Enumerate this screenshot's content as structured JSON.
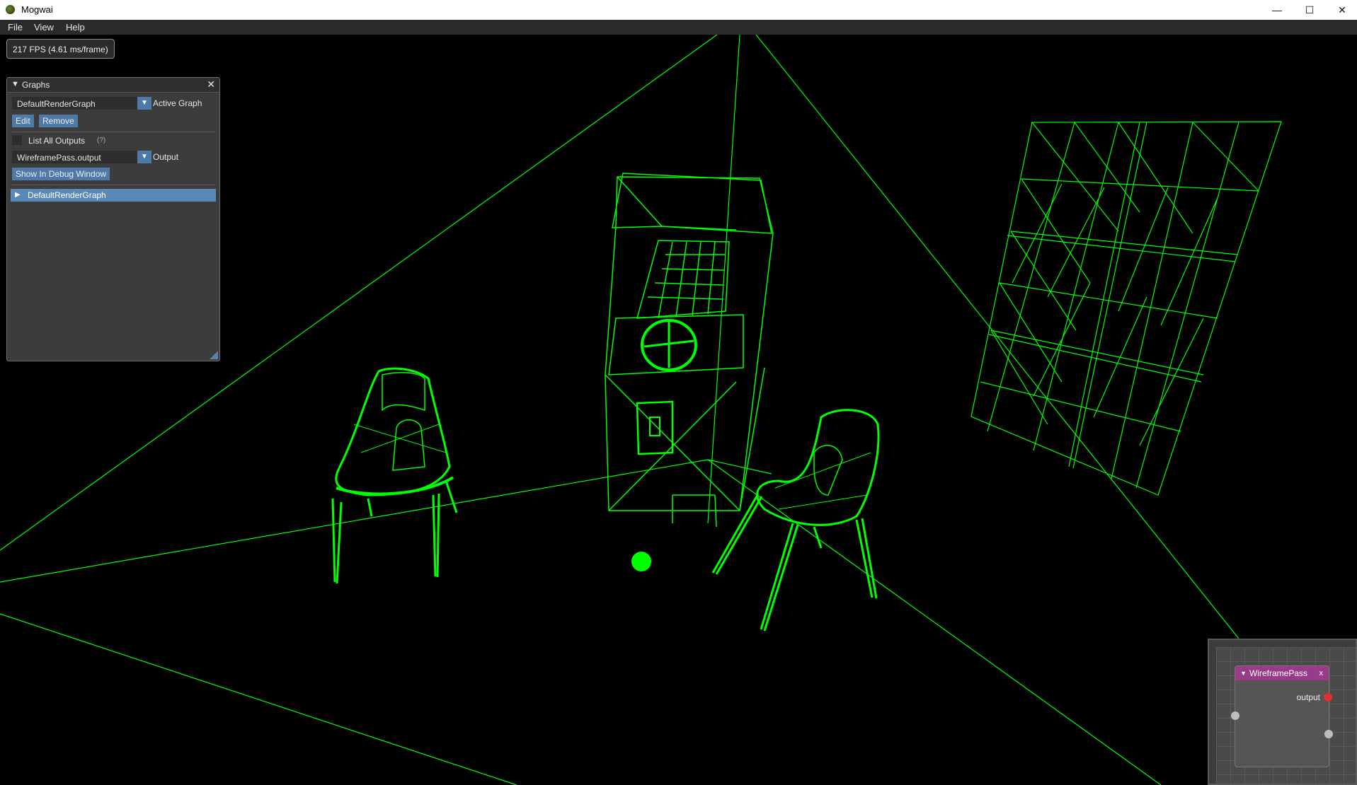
{
  "window": {
    "title": "Mogwai",
    "icon": "mogwai-app-icon",
    "controls": {
      "minimize": "—",
      "maximize": "☐",
      "close": "✕"
    }
  },
  "menu": {
    "items": [
      "File",
      "View",
      "Help"
    ]
  },
  "fps": {
    "text": "217 FPS (4.61 ms/frame)"
  },
  "graphs_panel": {
    "title": "Graphs",
    "close_glyph": "✕",
    "active_graph_value": "DefaultRenderGraph",
    "active_graph_label": "Active Graph",
    "edit_label": "Edit",
    "remove_label": "Remove",
    "list_all_outputs_label": "List All Outputs",
    "help_marker": "(?)",
    "output_value": "WireframePass.output",
    "output_label": "Output",
    "debug_button": "Show In Debug Window",
    "tree_item": "DefaultRenderGraph"
  },
  "graph_editor": {
    "node_title": "WireframePass",
    "node_close": "x",
    "output_label": "output"
  },
  "colors": {
    "wireframe": "#00ff00",
    "accent": "#4f7aa7",
    "node_header": "#9a3a8a",
    "pin_output": "#e03030"
  }
}
